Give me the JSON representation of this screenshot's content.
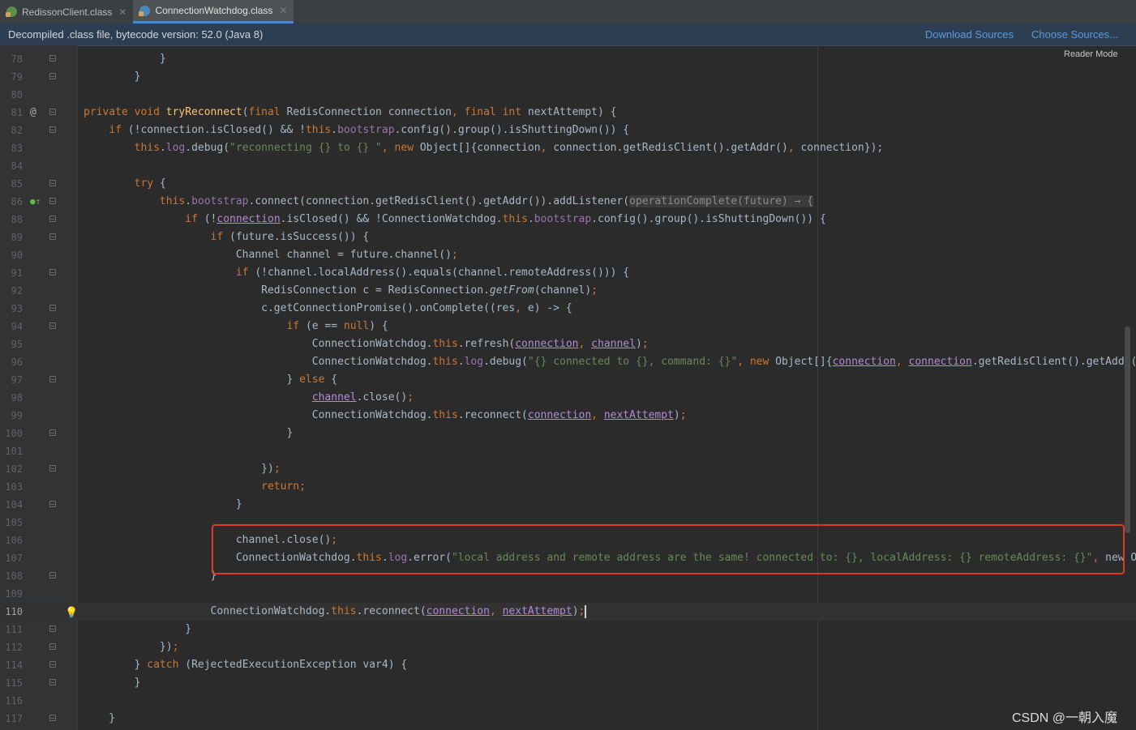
{
  "tabs": [
    {
      "label": "RedissonClient.class",
      "active": false,
      "icon": "class-file-green-icon"
    },
    {
      "label": "ConnectionWatchdog.class",
      "active": true,
      "icon": "class-file-blue-icon"
    }
  ],
  "banner": {
    "text": "Decompiled .class file, bytecode version: 52.0 (Java 8)",
    "download_sources": "Download Sources",
    "choose_sources": "Choose Sources..."
  },
  "reader_mode": "Reader Mode",
  "watermark": "CSDN @一朝入魔",
  "colors": {
    "background": "#2b2b2b",
    "keyword": "#cc7832",
    "field": "#9876aa",
    "string": "#6a8759",
    "function": "#ffc66d",
    "highlight_box": "#e0392b",
    "link": "#5a9bdc"
  },
  "code_lines": [
    {
      "num": "78",
      "fold": true,
      "tokens": [
        [
          "",
          "            }"
        ]
      ]
    },
    {
      "num": "79",
      "fold": true,
      "tokens": [
        [
          "",
          "        }"
        ]
      ]
    },
    {
      "num": "80",
      "tokens": []
    },
    {
      "num": "81",
      "fold": true,
      "mark": "@",
      "tokens": [
        [
          "kw",
          "private void "
        ],
        [
          "fn",
          "tryReconnect"
        ],
        [
          "",
          "("
        ],
        [
          "kw",
          "final "
        ],
        [
          "",
          "RedisConnection connection"
        ],
        [
          "kw",
          ", final int "
        ],
        [
          "",
          "nextAttempt) {"
        ]
      ]
    },
    {
      "num": "82",
      "fold": true,
      "tokens": [
        [
          "",
          "    "
        ],
        [
          "kw",
          "if "
        ],
        [
          "",
          "(!connection.isClosed() && !"
        ],
        [
          "kw",
          "this"
        ],
        [
          "",
          "."
        ],
        [
          "fld",
          "bootstrap"
        ],
        [
          "",
          ".config().group().isShuttingDown()) {"
        ]
      ]
    },
    {
      "num": "83",
      "tokens": [
        [
          "",
          "        "
        ],
        [
          "kw",
          "this"
        ],
        [
          "",
          "."
        ],
        [
          "fld",
          "log"
        ],
        [
          "",
          ".debug("
        ],
        [
          "str",
          "\"reconnecting {} to {} \""
        ],
        [
          "kw",
          ", new "
        ],
        [
          "",
          "Object[]{connection"
        ],
        [
          "kw",
          ", "
        ],
        [
          "",
          "connection.getRedisClient().getAddr()"
        ],
        [
          "kw",
          ", "
        ],
        [
          "",
          "connection});"
        ]
      ]
    },
    {
      "num": "84",
      "tokens": []
    },
    {
      "num": "85",
      "fold": true,
      "tokens": [
        [
          "",
          "        "
        ],
        [
          "kw",
          "try "
        ],
        [
          "",
          "{"
        ]
      ]
    },
    {
      "num": "86",
      "fold": true,
      "mark": "impl",
      "tokens": [
        [
          "",
          "            "
        ],
        [
          "kw",
          "this"
        ],
        [
          "",
          "."
        ],
        [
          "fld",
          "bootstrap"
        ],
        [
          "",
          ".connect(connection.getRedisClient().getAddr()).addListener("
        ],
        [
          "hint",
          "operationComplete(future) → {"
        ]
      ]
    },
    {
      "num": "88",
      "fold": true,
      "tokens": [
        [
          "",
          "                "
        ],
        [
          "kw",
          "if "
        ],
        [
          "",
          "(!"
        ],
        [
          "ul",
          "connection"
        ],
        [
          "",
          ".isClosed() && !ConnectionWatchdog."
        ],
        [
          "kw",
          "this"
        ],
        [
          "",
          "."
        ],
        [
          "fld",
          "bootstrap"
        ],
        [
          "",
          ".config().group().isShuttingDown()) {"
        ]
      ]
    },
    {
      "num": "89",
      "fold": true,
      "tokens": [
        [
          "",
          "                    "
        ],
        [
          "kw",
          "if "
        ],
        [
          "",
          "(future.isSuccess()) {"
        ]
      ]
    },
    {
      "num": "90",
      "tokens": [
        [
          "",
          "                        Channel channel = future.channel()"
        ],
        [
          "kw",
          ";"
        ]
      ]
    },
    {
      "num": "91",
      "fold": true,
      "tokens": [
        [
          "",
          "                        "
        ],
        [
          "kw",
          "if "
        ],
        [
          "",
          "(!channel.localAddress().equals(channel.remoteAddress())) {"
        ]
      ]
    },
    {
      "num": "92",
      "tokens": [
        [
          "",
          "                            RedisConnection c = RedisConnection."
        ],
        [
          "it",
          "getFrom"
        ],
        [
          "",
          "(channel)"
        ],
        [
          "kw",
          ";"
        ]
      ]
    },
    {
      "num": "93",
      "fold": true,
      "tokens": [
        [
          "",
          "                            c.getConnectionPromise().onComplete((res"
        ],
        [
          "kw",
          ", "
        ],
        [
          "",
          "e) -> {"
        ]
      ]
    },
    {
      "num": "94",
      "fold": true,
      "tokens": [
        [
          "",
          "                                "
        ],
        [
          "kw",
          "if "
        ],
        [
          "",
          "(e == "
        ],
        [
          "kw",
          "null"
        ],
        [
          "",
          ") {"
        ]
      ]
    },
    {
      "num": "95",
      "tokens": [
        [
          "",
          "                                    ConnectionWatchdog."
        ],
        [
          "kw",
          "this"
        ],
        [
          "",
          ".refresh("
        ],
        [
          "ul",
          "connection"
        ],
        [
          "kw",
          ", "
        ],
        [
          "ul",
          "channel"
        ],
        [
          "",
          ")"
        ],
        [
          "kw",
          ";"
        ]
      ]
    },
    {
      "num": "96",
      "tokens": [
        [
          "",
          "                                    ConnectionWatchdog."
        ],
        [
          "kw",
          "this"
        ],
        [
          "",
          "."
        ],
        [
          "fld",
          "log"
        ],
        [
          "",
          ".debug("
        ],
        [
          "str",
          "\"{} connected to {}, command: {}\""
        ],
        [
          "kw",
          ", new "
        ],
        [
          "",
          "Object[]{"
        ],
        [
          "ul",
          "connection"
        ],
        [
          "kw",
          ", "
        ],
        [
          "ul",
          "connection"
        ],
        [
          "",
          ".getRedisClient().getAddr()"
        ]
      ]
    },
    {
      "num": "97",
      "fold": true,
      "tokens": [
        [
          "",
          "                                } "
        ],
        [
          "kw",
          "else "
        ],
        [
          "",
          "{"
        ]
      ]
    },
    {
      "num": "98",
      "tokens": [
        [
          "",
          "                                    "
        ],
        [
          "ul",
          "channel"
        ],
        [
          "",
          ".close()"
        ],
        [
          "kw",
          ";"
        ]
      ]
    },
    {
      "num": "99",
      "tokens": [
        [
          "",
          "                                    ConnectionWatchdog."
        ],
        [
          "kw",
          "this"
        ],
        [
          "",
          ".reconnect("
        ],
        [
          "ul",
          "connection"
        ],
        [
          "kw",
          ", "
        ],
        [
          "ul",
          "nextAttempt"
        ],
        [
          "",
          ")"
        ],
        [
          "kw",
          ";"
        ]
      ]
    },
    {
      "num": "100",
      "fold": true,
      "tokens": [
        [
          "",
          "                                }"
        ]
      ]
    },
    {
      "num": "101",
      "tokens": []
    },
    {
      "num": "102",
      "fold": true,
      "tokens": [
        [
          "",
          "                            })"
        ],
        [
          "kw",
          ";"
        ]
      ]
    },
    {
      "num": "103",
      "tokens": [
        [
          "",
          "                            "
        ],
        [
          "kw",
          "return;"
        ]
      ]
    },
    {
      "num": "104",
      "fold": true,
      "tokens": [
        [
          "",
          "                        }"
        ]
      ]
    },
    {
      "num": "105",
      "tokens": []
    },
    {
      "num": "106",
      "tokens": [
        [
          "",
          "                        channel.close()"
        ],
        [
          "kw",
          ";"
        ]
      ]
    },
    {
      "num": "107",
      "tokens": [
        [
          "",
          "                        ConnectionWatchdog."
        ],
        [
          "kw",
          "this"
        ],
        [
          "",
          "."
        ],
        [
          "fld",
          "log"
        ],
        [
          "",
          ".error("
        ],
        [
          "str",
          "\"local address and remote address are the same! connected to: {}, localAddress: {} remoteAddress: {}\""
        ],
        [
          "kw",
          ", "
        ],
        [
          "",
          "new Object[]{"
        ]
      ]
    },
    {
      "num": "108",
      "fold": true,
      "tokens": [
        [
          "",
          "                    }"
        ]
      ]
    },
    {
      "num": "109",
      "tokens": []
    },
    {
      "num": "110",
      "current": true,
      "bulb": true,
      "tokens": [
        [
          "",
          "                    ConnectionWatchdog."
        ],
        [
          "kw",
          "this"
        ],
        [
          "",
          ".reconnect("
        ],
        [
          "ul",
          "connection"
        ],
        [
          "kw",
          ", "
        ],
        [
          "ul",
          "nextAttempt"
        ],
        [
          "",
          ")"
        ],
        [
          "kw",
          ";"
        ],
        [
          "caret",
          ""
        ]
      ]
    },
    {
      "num": "111",
      "fold": true,
      "tokens": [
        [
          "",
          "                }"
        ]
      ]
    },
    {
      "num": "112",
      "fold": true,
      "tokens": [
        [
          "",
          "            })"
        ],
        [
          "kw",
          ";"
        ]
      ]
    },
    {
      "num": "114",
      "fold": true,
      "tokens": [
        [
          "",
          "        } "
        ],
        [
          "kw",
          "catch "
        ],
        [
          "",
          "(RejectedExecutionException var4) {"
        ]
      ]
    },
    {
      "num": "115",
      "fold": true,
      "tokens": [
        [
          "",
          "        }"
        ]
      ]
    },
    {
      "num": "116",
      "tokens": []
    },
    {
      "num": "117",
      "fold": true,
      "tokens": [
        [
          "",
          "    }"
        ]
      ]
    }
  ]
}
